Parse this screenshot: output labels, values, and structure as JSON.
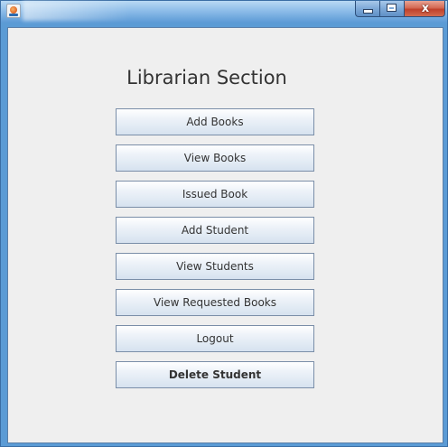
{
  "window": {
    "title": ""
  },
  "caption_buttons": {
    "close_glyph": "x"
  },
  "main": {
    "title": "Librarian Section",
    "buttons": [
      {
        "label": "Add Books",
        "bold": false
      },
      {
        "label": "View Books",
        "bold": false
      },
      {
        "label": "Issued Book",
        "bold": false
      },
      {
        "label": "Add Student",
        "bold": false
      },
      {
        "label": "View Students",
        "bold": false
      },
      {
        "label": "View Requested Books",
        "bold": false
      },
      {
        "label": "Logout",
        "bold": false
      },
      {
        "label": "Delete Student",
        "bold": true
      }
    ]
  },
  "colors": {
    "content_bg": "#efefef",
    "button_border": "#7a8ea8",
    "titlebar": "#5b9bd5",
    "close_button": "#c0412b"
  }
}
